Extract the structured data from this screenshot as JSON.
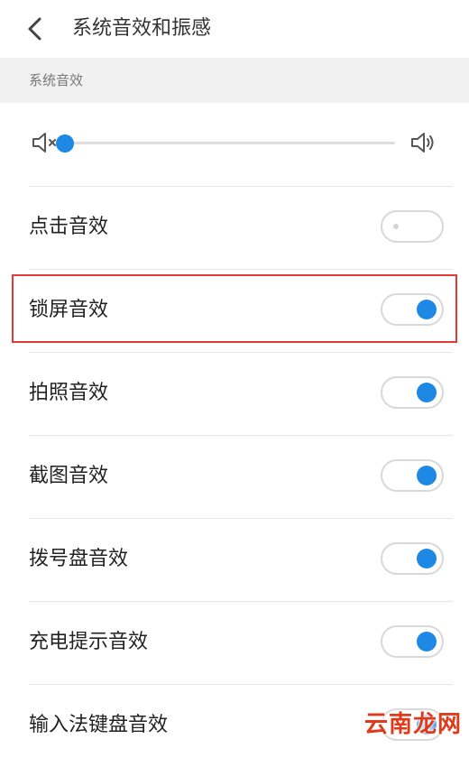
{
  "header": {
    "title": "系统音效和振感",
    "back_icon": "chevron-left-icon"
  },
  "section": {
    "title": "系统音效"
  },
  "volume": {
    "level": 0,
    "min_icon": "volume-mute-icon",
    "max_icon": "volume-high-icon",
    "accent_color": "#1e88e5"
  },
  "settings": [
    {
      "label": "点击音效",
      "enabled": false
    },
    {
      "label": "锁屏音效",
      "enabled": true,
      "highlighted": true
    },
    {
      "label": "拍照音效",
      "enabled": true
    },
    {
      "label": "截图音效",
      "enabled": true
    },
    {
      "label": "拨号盘音效",
      "enabled": true
    },
    {
      "label": "充电提示音效",
      "enabled": true
    },
    {
      "label": "输入法键盘音效",
      "enabled": true
    }
  ],
  "highlight_color": "#e53935",
  "watermark": "云南龙网"
}
